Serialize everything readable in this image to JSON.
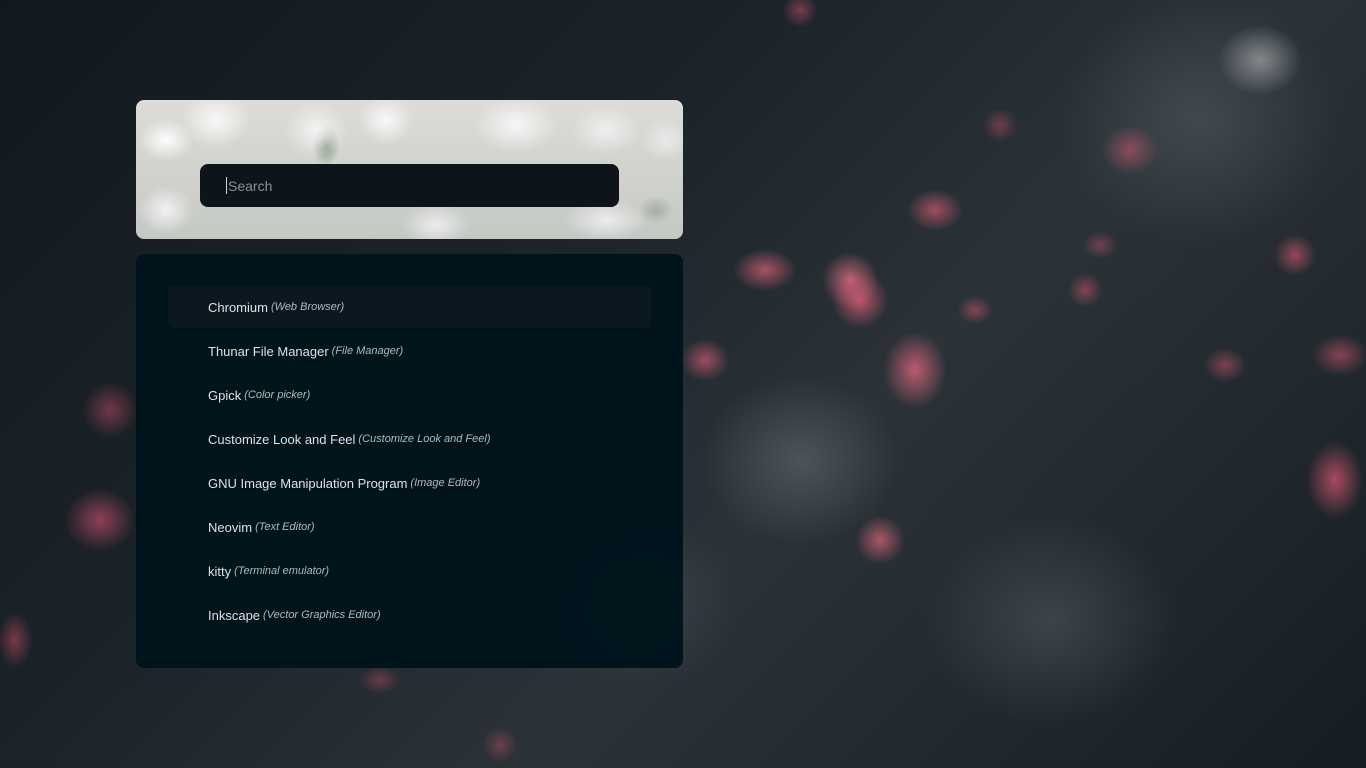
{
  "search": {
    "placeholder": "Search",
    "value": ""
  },
  "results": [
    {
      "name": "Chromium",
      "description": "(Web Browser)",
      "selected": true
    },
    {
      "name": "Thunar File Manager",
      "description": "(File Manager)",
      "selected": false
    },
    {
      "name": "Gpick",
      "description": "(Color picker)",
      "selected": false
    },
    {
      "name": "Customize Look and Feel",
      "description": "(Customize Look and Feel)",
      "selected": false
    },
    {
      "name": "GNU Image Manipulation Program",
      "description": "(Image Editor)",
      "selected": false
    },
    {
      "name": "Neovim",
      "description": "(Text Editor)",
      "selected": false
    },
    {
      "name": "kitty",
      "description": "(Terminal emulator)",
      "selected": false
    },
    {
      "name": "Inkscape",
      "description": "(Vector Graphics Editor)",
      "selected": false
    }
  ],
  "colors": {
    "panel_background": "#00141c",
    "search_background": "#0d151b",
    "selected_row": "#0c1820",
    "text": "#e6e8ea"
  }
}
